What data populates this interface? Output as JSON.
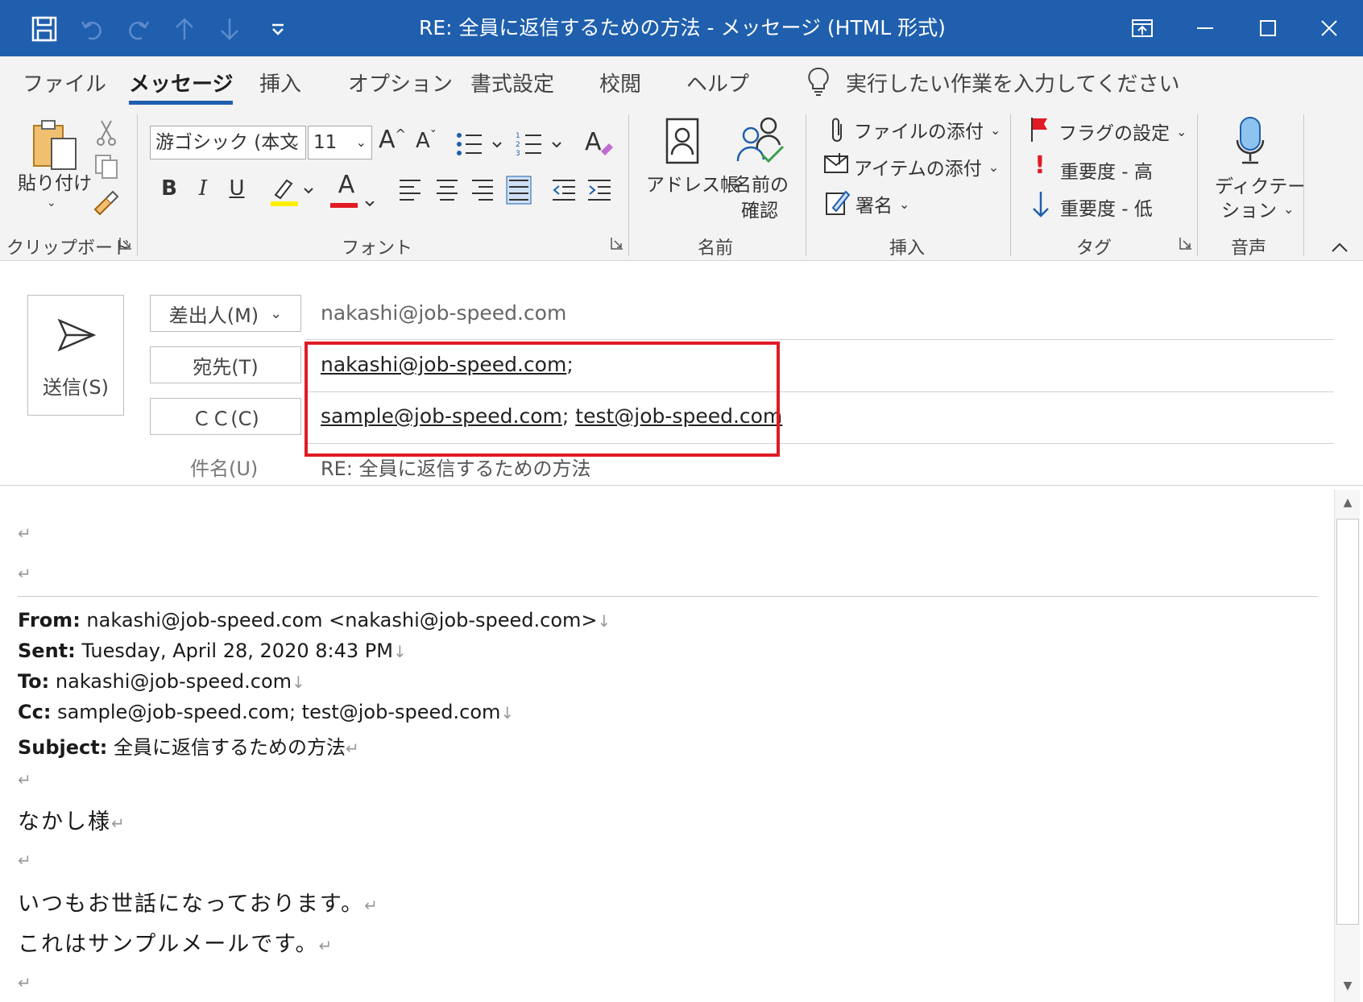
{
  "window": {
    "title": "RE: 全員に返信するための方法  -  メッセージ (HTML 形式)"
  },
  "tabs": [
    "ファイル",
    "メッセージ",
    "挿入",
    "オプション",
    "書式設定",
    "校閲",
    "ヘルプ"
  ],
  "tell_me": "実行したい作業を入力してください",
  "ribbon": {
    "clipboard": {
      "paste": "貼り付け",
      "group": "クリップボード"
    },
    "font": {
      "name": "游ゴシック (本文",
      "size": "11",
      "group": "フォント",
      "bold": "B",
      "italic": "I",
      "underline": "U",
      "font_color": "A",
      "grow": "A",
      "shrink": "A",
      "clear": "A"
    },
    "names": {
      "address_book": "アドレス帳",
      "check_names_1": "名前の",
      "check_names_2": "確認",
      "group": "名前"
    },
    "insert": {
      "attach_file": "ファイルの添付",
      "attach_item": "アイテムの添付",
      "signature": "署名",
      "group": "挿入"
    },
    "tags": {
      "flag": "フラグの設定",
      "importance_high": "重要度 - 高",
      "importance_low": "重要度 - 低",
      "group": "タグ"
    },
    "voice": {
      "dictate_1": "ディクテー",
      "dictate_2": "ション",
      "group": "音声"
    }
  },
  "header": {
    "send_label": "送信(S)",
    "from_label": "差出人(M)",
    "from_value": "nakashi@job-speed.com",
    "to_label": "宛先(T)",
    "to_value": "nakashi@job-speed.com",
    "to_suffix": ";",
    "cc_label": "ＣＣ(C)",
    "cc_value_1": "sample@job-speed.com",
    "cc_sep": ";",
    "cc_value_2": "test@job-speed.com",
    "subject_label": "件名(U)",
    "subject_value": "RE: 全員に返信するための方法"
  },
  "body": {
    "para_mark": "↵",
    "line_mark": "↓",
    "from_label": "From:",
    "from_value": " nakashi@job-speed.com <nakashi@job-speed.com>",
    "sent_label": "Sent:",
    "sent_value": " Tuesday, April 28, 2020 8:43 PM",
    "to_label": "To:",
    "to_value": " nakashi@job-speed.com",
    "cc_label": "Cc:",
    "cc_value": " sample@job-speed.com; test@job-speed.com",
    "subject_label": "Subject:",
    "subject_value": " 全員に返信するための方法",
    "greeting": "なかし様",
    "line1": "いつもお世話になっております。",
    "line2": "これはサンプルメールです。"
  },
  "colors": {
    "titlebar": "#1f5fae",
    "highlight": "#e01b24",
    "ribbon_bg": "#f3f3f3"
  }
}
